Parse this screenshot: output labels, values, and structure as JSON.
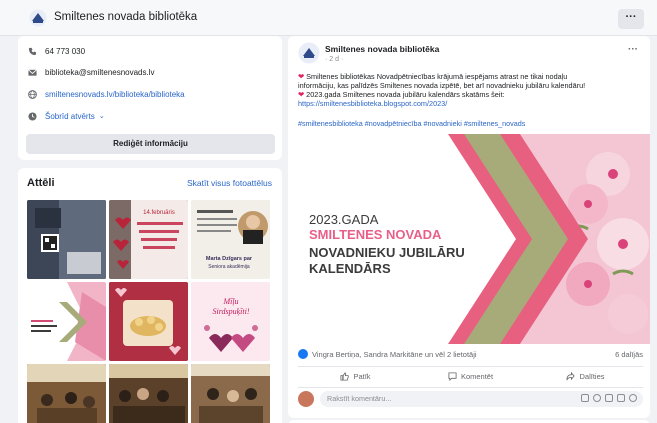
{
  "header": {
    "page_name": "Smiltenes novada bibliotēka",
    "more_label": "···"
  },
  "intro": {
    "phone": "64 773 030",
    "email": "biblioteka@smiltenesnovads.lv",
    "website": "smiltenesnovads.lv/biblioteka/biblioteka",
    "hours": "Šobrīd atvērts",
    "edit_button": "Rediģēt informāciju"
  },
  "photos": {
    "title": "Attēli",
    "see_all": "Skatīt visus fotoattēlus",
    "thumbs": [
      {
        "caption": "INTERNETA DEŅI BIBLIOTĒKĀ"
      },
      {
        "caption": "14.februāris Sirsniņas radīšana kopā ar bibliotēku"
      },
      {
        "caption": "Marta Dzīgars par Seniora akadēmija"
      },
      {
        "caption": "SMILTENES BIBLIOTĒKĀS"
      },
      {
        "caption": ""
      },
      {
        "caption": "Mīļu Sirdspuķīti!"
      },
      {
        "caption": ""
      },
      {
        "caption": ""
      },
      {
        "caption": ""
      }
    ]
  },
  "post": {
    "author": "Smiltenes novada bibliotēka",
    "meta": "· 2 d ·",
    "more": "···",
    "line1": "Smiltenes bibliotēkas Novadpētniecības krājumā iespējams atrast ne tikai nodaļu",
    "line2": "informāciju, kas palīdzēs Smiltenes novada izpētē, bet arī novadnieku jubilāru kalendāru!",
    "line3": "2023.gada Smiltenes novada jubilāru kalendārs skatāms šeit:",
    "link": "https://smiltenesbiblioteka.blogspot.com/2023/",
    "hashtags": "#smiltenesbiblioteka #novadpētniecība #novadnieki #smiltenes_novads",
    "image": {
      "line1": "2023.GADA",
      "line2": "SMILTENES NOVADA",
      "line3": "NOVADNIEKU JUBILĀRU",
      "line4": "KALENDĀRS"
    },
    "reactions_text": "Vingra Bertiņa, Sandra Markitāne un vēl 2 lietotāji",
    "shares_count": "6 dalījās",
    "actions": {
      "like": "Patīk",
      "comment": "Komentēt",
      "share": "Dalīties"
    },
    "comment_placeholder": "Rakstīt komentāru..."
  },
  "colors": {
    "accent": "#1877f2",
    "pink": "#e8608a",
    "olive": "#a7ab7a",
    "link": "#2a66c8"
  }
}
